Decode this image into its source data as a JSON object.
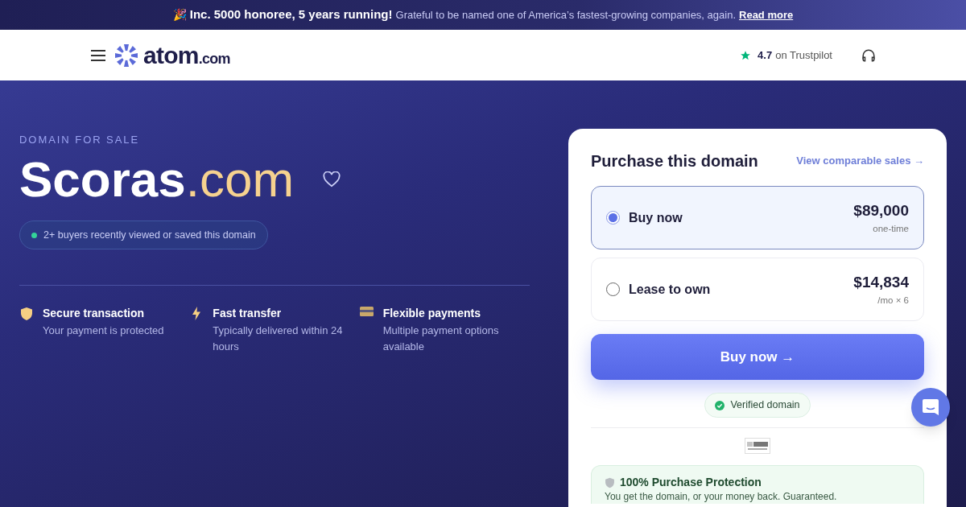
{
  "announcement": {
    "emoji": "🎉",
    "headline": "Inc. 5000 honoree, 5 years running!",
    "text": "Grateful to be named one of America’s fastest-growing companies, again.",
    "link": "Read more"
  },
  "header": {
    "logo_text": "atom",
    "logo_suffix": ".com",
    "rating": "4.7",
    "rating_source": "on Trustpilot"
  },
  "hero": {
    "eyebrow": "DOMAIN FOR SALE",
    "name": "Scoras",
    "tld": ".com",
    "favorited": false,
    "activity": "2+ buyers recently viewed or saved this domain",
    "features": [
      {
        "kind": "shield",
        "title": "Secure transaction",
        "text": "Your payment is protected"
      },
      {
        "kind": "bolt",
        "title": "Fast transfer",
        "text": "Typically delivered within 24 hours"
      },
      {
        "kind": "card",
        "title": "Flexible payments",
        "text": "Multiple payment options available"
      }
    ]
  },
  "purchase": {
    "title": "Purchase this domain",
    "link": "View comparable sales →",
    "options": [
      {
        "label": "Buy now",
        "price": "$89,000",
        "note": "one-time",
        "selected": true
      },
      {
        "label": "Lease to own",
        "price": "$14,834",
        "note": "/mo × 6",
        "selected": false
      }
    ],
    "button": "Buy now →",
    "verified": "Verified domain",
    "protection": {
      "title": "100% Purchase Protection",
      "text": "You get the domain, or your money back. Guaranteed."
    }
  }
}
